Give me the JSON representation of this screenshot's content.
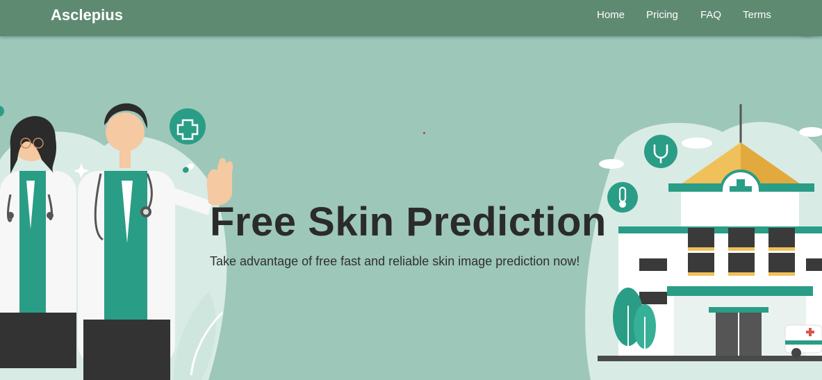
{
  "navbar": {
    "brand": "Asclepius",
    "links": [
      "Home",
      "Pricing",
      "FAQ",
      "Terms"
    ]
  },
  "hero": {
    "title": "Free Skin Prediction",
    "subtitle": "Take advantage of free fast and reliable skin image prediction now!"
  },
  "icons": {
    "lens": "lens-search-icon",
    "medical_cross": "medical-cross-icon",
    "stethoscope": "stethoscope-icon",
    "thermometer": "thermometer-icon"
  },
  "colors": {
    "navbar": "#5f8a72",
    "background": "#9dc7b9",
    "teal": "#2a9d86",
    "accent_yellow": "#f0c15a",
    "text_dark": "#2b2b2b"
  }
}
